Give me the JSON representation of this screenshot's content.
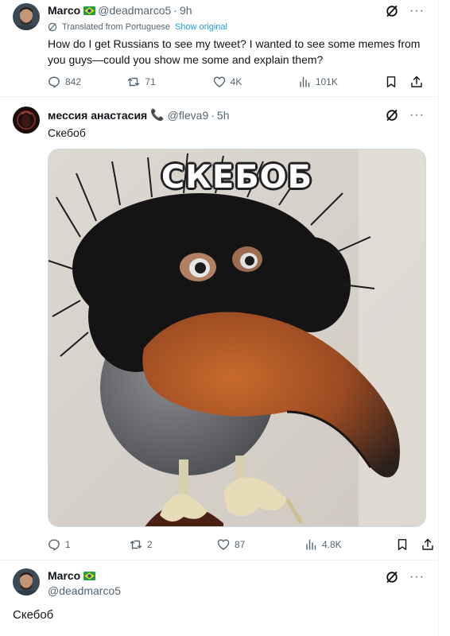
{
  "colors": {
    "accent": "#1d9bf0",
    "text": "#0f1419",
    "muted": "#536471",
    "divider": "#eff3f4"
  },
  "tweet1": {
    "name": "Marco",
    "badge_icon": "brazil-flag-icon",
    "handle": "@deadmarco5",
    "separator": "·",
    "time": "9h",
    "translated_label": "Translated from Portuguese",
    "show_original": "Show original",
    "text": "How do I get Russians to see my tweet? I wanted to see some memes from you guys—could you show me some and explain them?",
    "stats": {
      "replies": "842",
      "reposts": "71",
      "likes": "4K",
      "views": "101K"
    }
  },
  "tweet2": {
    "name": "мессия анастасия",
    "badge_icon": "phone-icon",
    "badge_glyph": "📞",
    "handle": "@fleva9",
    "separator": "·",
    "time": "5h",
    "text": "Скебоб",
    "image_caption": "СКЕБОБ",
    "stats": {
      "replies": "1",
      "reposts": "2",
      "likes": "87",
      "views": "4.8K"
    }
  },
  "tweet3": {
    "name": "Marco",
    "badge_icon": "brazil-flag-icon",
    "handle": "@deadmarco5",
    "text": "Скебоб"
  }
}
